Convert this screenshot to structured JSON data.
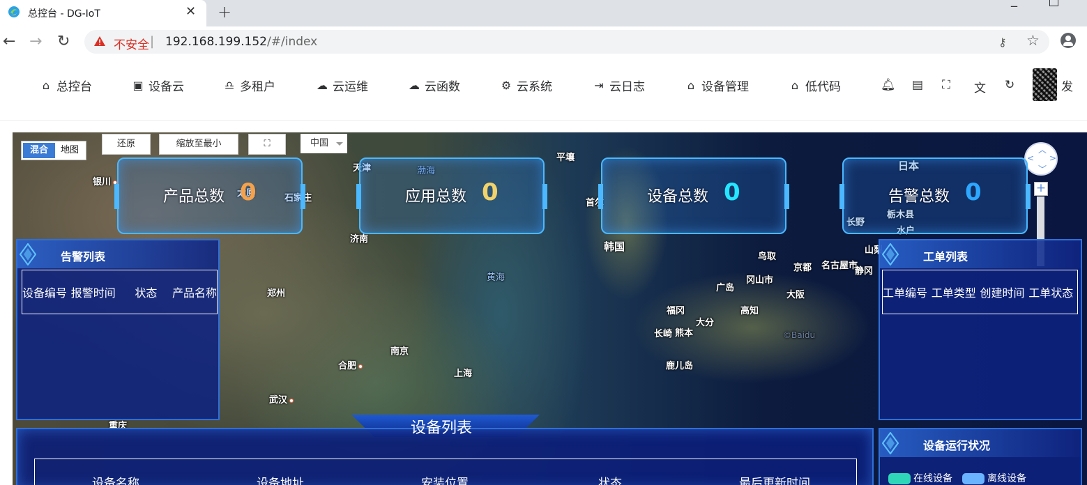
{
  "browser": {
    "tab_title": "总控台 - DG-IoT",
    "tab_close": "✕",
    "new_tab": "+",
    "insecure_label": "不安全",
    "separator": "|",
    "url_host": "192.168.199.152",
    "url_path": "/#/index"
  },
  "nav": {
    "items": [
      {
        "label": "总控台",
        "icon": "home-icon"
      },
      {
        "label": "设备云",
        "icon": "user-card-icon"
      },
      {
        "label": "多租户",
        "icon": "users-icon"
      },
      {
        "label": "云运维",
        "icon": "cloud-ops-icon"
      },
      {
        "label": "云函数",
        "icon": "cloud-icon"
      },
      {
        "label": "云系统",
        "icon": "system-icon"
      },
      {
        "label": "云日志",
        "icon": "log-icon"
      },
      {
        "label": "设备管理",
        "icon": "home-filled-icon"
      },
      {
        "label": "低代码",
        "icon": "home-filled-icon"
      }
    ],
    "user_name": "发"
  },
  "map": {
    "mode_hybrid": "混合",
    "mode_map": "地图",
    "restore": "还原",
    "zoom_min": "缩放至最小",
    "fullscreen": "⛶",
    "region": "中国",
    "labels": [
      {
        "text": "银川",
        "dot": true
      },
      {
        "text": "天津",
        "dot": false
      },
      {
        "text": "渤海",
        "dot": false,
        "sea": true
      },
      {
        "text": "平壤",
        "dot": false
      },
      {
        "text": "太原",
        "dot": false
      },
      {
        "text": "石家庄",
        "dot": false
      },
      {
        "text": "首尔",
        "dot": false
      },
      {
        "text": "日本",
        "dot": false
      },
      {
        "text": "济南",
        "dot": false
      },
      {
        "text": "韩国",
        "dot": false
      },
      {
        "text": "长野",
        "dot": false
      },
      {
        "text": "栃木县",
        "dot": false
      },
      {
        "text": "水户",
        "dot": false
      },
      {
        "text": "鸟取",
        "dot": false
      },
      {
        "text": "京都",
        "dot": false
      },
      {
        "text": "名古屋市",
        "dot": false
      },
      {
        "text": "静冈",
        "dot": false
      },
      {
        "text": "山梨",
        "dot": false
      },
      {
        "text": "黄海",
        "dot": false,
        "sea": true
      },
      {
        "text": "冈山市",
        "dot": false
      },
      {
        "text": "广岛",
        "dot": false
      },
      {
        "text": "大阪",
        "dot": false
      },
      {
        "text": "郑州",
        "dot": false
      },
      {
        "text": "福冈",
        "dot": false
      },
      {
        "text": "高知",
        "dot": false
      },
      {
        "text": "大分",
        "dot": false
      },
      {
        "text": "长崎",
        "dot": false
      },
      {
        "text": "熊本",
        "dot": false
      },
      {
        "text": "©Baidu",
        "dot": false,
        "sea": true
      },
      {
        "text": "南京",
        "dot": false
      },
      {
        "text": "合肥",
        "dot": true
      },
      {
        "text": "鹿儿岛",
        "dot": false
      },
      {
        "text": "上海",
        "dot": false
      },
      {
        "text": "武汉",
        "dot": true
      },
      {
        "text": "重庆",
        "dot": false
      }
    ]
  },
  "stats": [
    {
      "label": "产品总数",
      "value": "0",
      "color": "#f5a24b"
    },
    {
      "label": "应用总数",
      "value": "0",
      "color": "#f2d36b"
    },
    {
      "label": "设备总数",
      "value": "0",
      "color": "#25e6ff"
    },
    {
      "label": "告警总数",
      "value": "0",
      "color": "#2da7ff"
    }
  ],
  "alarm_panel": {
    "title": "告警列表",
    "columns": [
      "设备编号",
      "报警时间",
      "状态",
      "产品名称"
    ]
  },
  "order_panel": {
    "title": "工单列表",
    "columns": [
      "工单编号",
      "工单类型",
      "创建时间",
      "工单状态"
    ]
  },
  "device_list": {
    "title": "设备列表",
    "columns": [
      "设备名称",
      "设备地址",
      "安装位置",
      "状态",
      "最后更新时间"
    ]
  },
  "device_status": {
    "title": "设备运行状况",
    "online": {
      "label": "在线设备",
      "color": "#2fd7b8"
    },
    "offline": {
      "label": "离线设备",
      "color": "#6ab3ff"
    }
  },
  "colors": {
    "panel_bg": "#0e2280",
    "panel_border": "#2f6fd8",
    "accent": "#4bb8ff"
  }
}
